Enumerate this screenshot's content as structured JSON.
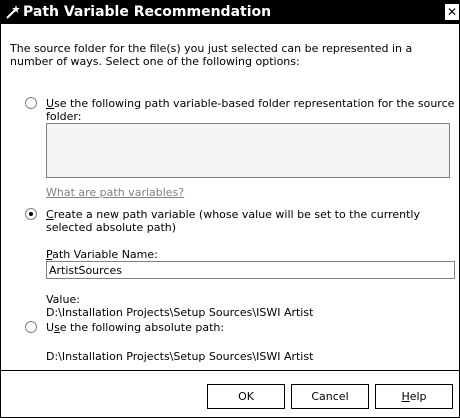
{
  "window": {
    "title": "Path Variable Recommendation",
    "close_glyph": "✕"
  },
  "intro_text": "The source folder for the file(s) you just selected can be represented in a number of ways. Select one of the following options:",
  "options": {
    "option1": {
      "label_first": "U",
      "label_rest": "se the following path variable-based folder representation for the source folder:",
      "selected": false
    },
    "link_text": "What are path variables?",
    "option2": {
      "label_first": "C",
      "label_rest": "reate a new path variable (whose value will be set to the currently selected absolute path)",
      "selected": true
    },
    "path_variable_name_first": "P",
    "path_variable_name_rest": "ath Variable Name:",
    "path_variable_name_value": "ArtistSources",
    "value_label": "Value:",
    "value_text": "D:\\Installation Projects\\Setup Sources\\ISWI Artist",
    "option3": {
      "label_pre": "U",
      "label_underlined": "s",
      "label_rest": "e the following absolute path:",
      "selected": false
    },
    "absolute_path": "D:\\Installation Projects\\Setup Sources\\ISWI Artist"
  },
  "buttons": {
    "ok": "OK",
    "cancel": "Cancel",
    "help_first": "H",
    "help_rest": "elp"
  }
}
